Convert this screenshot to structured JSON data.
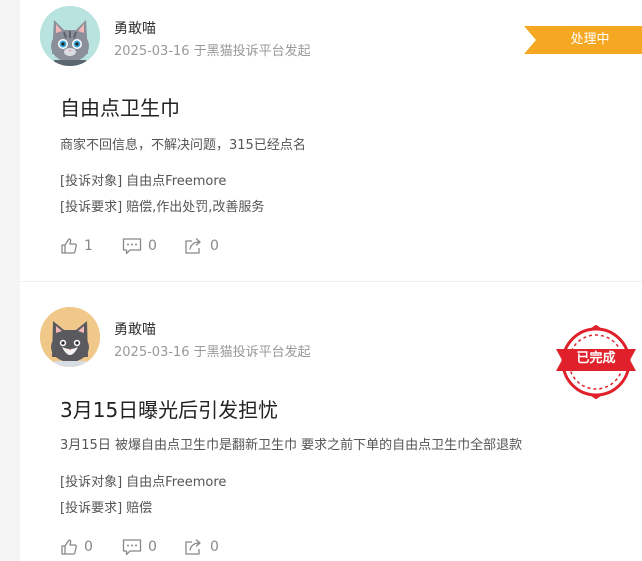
{
  "complaints": [
    {
      "user": "勇敢喵",
      "date": "2025-03-16",
      "source": "于黑猫投诉平台发起",
      "status": "处理中",
      "status_color": "#f6a823",
      "title": "自由点卫生巾",
      "description": "商家不回信息，不解决问题，315已经点名",
      "target_label": "[投诉对象]",
      "target_value": "自由点Freemore",
      "request_label": "[投诉要求]",
      "request_value": "赔偿,作出处罚,改善服务",
      "likes": "1",
      "comments": "0",
      "shares": "0"
    },
    {
      "user": "勇敢喵",
      "date": "2025-03-16",
      "source": "于黑猫投诉平台发起",
      "status": "已完成",
      "status_color": "#e0202a",
      "title": "3月15日曝光后引发担忧",
      "description": "3月15日 被爆自由点卫生巾是翻新卫生巾 要求之前下单的自由点卫生巾全部退款",
      "target_label": "[投诉对象]",
      "target_value": "自由点Freemore",
      "request_label": "[投诉要求]",
      "request_value": "赔偿",
      "likes": "0",
      "comments": "0",
      "shares": "0"
    }
  ]
}
